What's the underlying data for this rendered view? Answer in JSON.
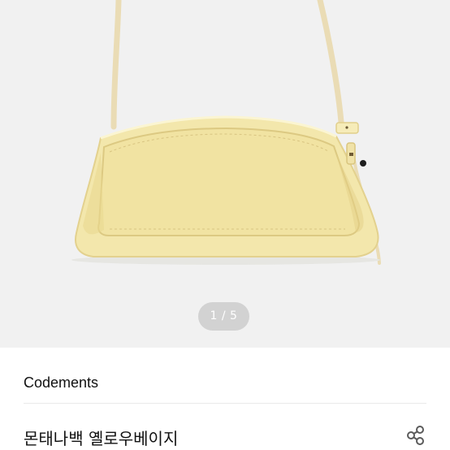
{
  "gallery": {
    "indicator": "1 / 5",
    "product_color": "#f3e7ac"
  },
  "product": {
    "brand": "Codements",
    "title": "몬태나백 옐로우베이지"
  },
  "actions": {
    "share_icon": "share-icon"
  },
  "colors": {
    "background": "#f1f1f1",
    "text": "#111111"
  }
}
